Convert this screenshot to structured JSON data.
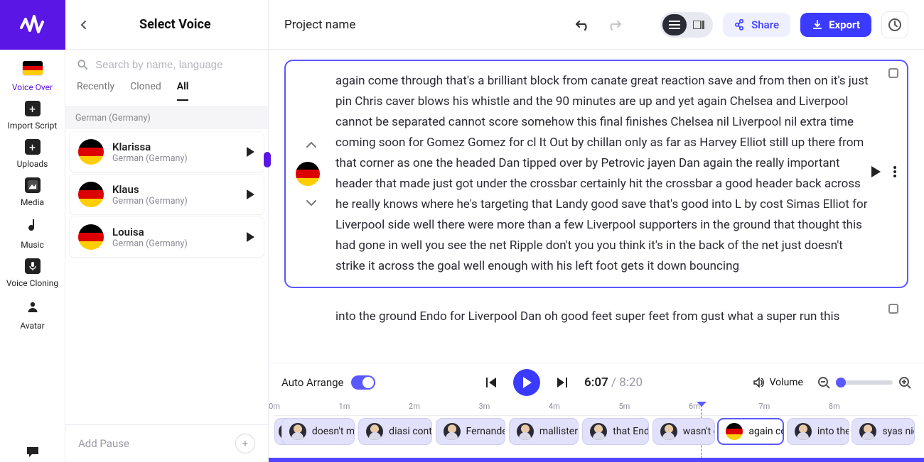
{
  "rail": {
    "voice_over": "Voice Over",
    "import_script": "Import Script",
    "uploads": "Uploads",
    "media": "Media",
    "music": "Music",
    "voice_cloning": "Voice Cloning",
    "avatar": "Avatar"
  },
  "voice_panel": {
    "title": "Select Voice",
    "search_placeholder": "Search by name, language",
    "tabs": [
      "Recently",
      "Cloned",
      "All"
    ],
    "active_tab": "All",
    "group": "German (Germany)",
    "voices": [
      {
        "name": "Klarissa",
        "lang": "German (Germany)"
      },
      {
        "name": "Klaus",
        "lang": "German (Germany)"
      },
      {
        "name": "Louisa",
        "lang": "German (Germany)"
      }
    ],
    "add_pause": "Add Pause"
  },
  "topbar": {
    "project_name": "Project name",
    "share": "Share",
    "export": "Export"
  },
  "blocks": {
    "active_text": "again come through that's a brilliant block from canate great reaction save and from then on it's just pin Chris caver blows his whistle and the 90 minutes are up and yet again Chelsea and Liverpool cannot be separated cannot score somehow this final finishes Chelsea nil Liverpool nil extra time coming soon for Gomez Gomez for cl It Out by chillan only as far as Harvey Elliot still up there from that corner as one the headed Dan tipped over by Petrovic jayen Dan again the really important header that made just got under the crossbar certainly hit the crossbar a good header back across he really knows where he's targeting that Landy good save that's good into L by cost Simas Elliot for Liverpool side well there were more than a few Liverpool supporters in the ground that thought this had gone in well you see the net Ripple don't you you think it's in the back of the net just doesn't strike it across the goal well enough with his left foot gets it down bouncing",
    "next_text": "into the ground Endo for Liverpool Dan oh good feet super feet from gust what a super run this"
  },
  "player": {
    "auto_arrange": "Auto Arrange",
    "current": "6:07",
    "duration": "8:20",
    "volume_label": "Volume"
  },
  "timeline": {
    "markers": [
      "0m",
      "1m",
      "2m",
      "3m",
      "4m",
      "5m",
      "6m",
      "7m",
      "8m"
    ],
    "playhead_minutes": 6.07,
    "clips": [
      {
        "label": "doesn't ma",
        "start": 0.1,
        "dur": 1.05,
        "avatar": "person"
      },
      {
        "label": "diasi contre",
        "start": 1.2,
        "dur": 1.05,
        "avatar": "person"
      },
      {
        "label": "Fernandez",
        "start": 2.3,
        "dur": 1.0,
        "avatar": "person"
      },
      {
        "label": "mallister h",
        "start": 3.35,
        "dur": 1.0,
        "avatar": "person"
      },
      {
        "label": "that Endo i",
        "start": 4.4,
        "dur": 0.95,
        "avatar": "person"
      },
      {
        "label": "wasn't gc",
        "start": 5.4,
        "dur": 0.9,
        "avatar": "person"
      },
      {
        "label": "again come t",
        "start": 6.33,
        "dur": 0.95,
        "avatar": "flag",
        "selected": true
      },
      {
        "label": "into the gr",
        "start": 7.32,
        "dur": 0.9,
        "avatar": "person"
      },
      {
        "label": "syas nicely",
        "start": 8.25,
        "dur": 0.9,
        "avatar": "person"
      }
    ],
    "track_minutes": 9.2,
    "head_avatar_left_pct": 0.5
  }
}
